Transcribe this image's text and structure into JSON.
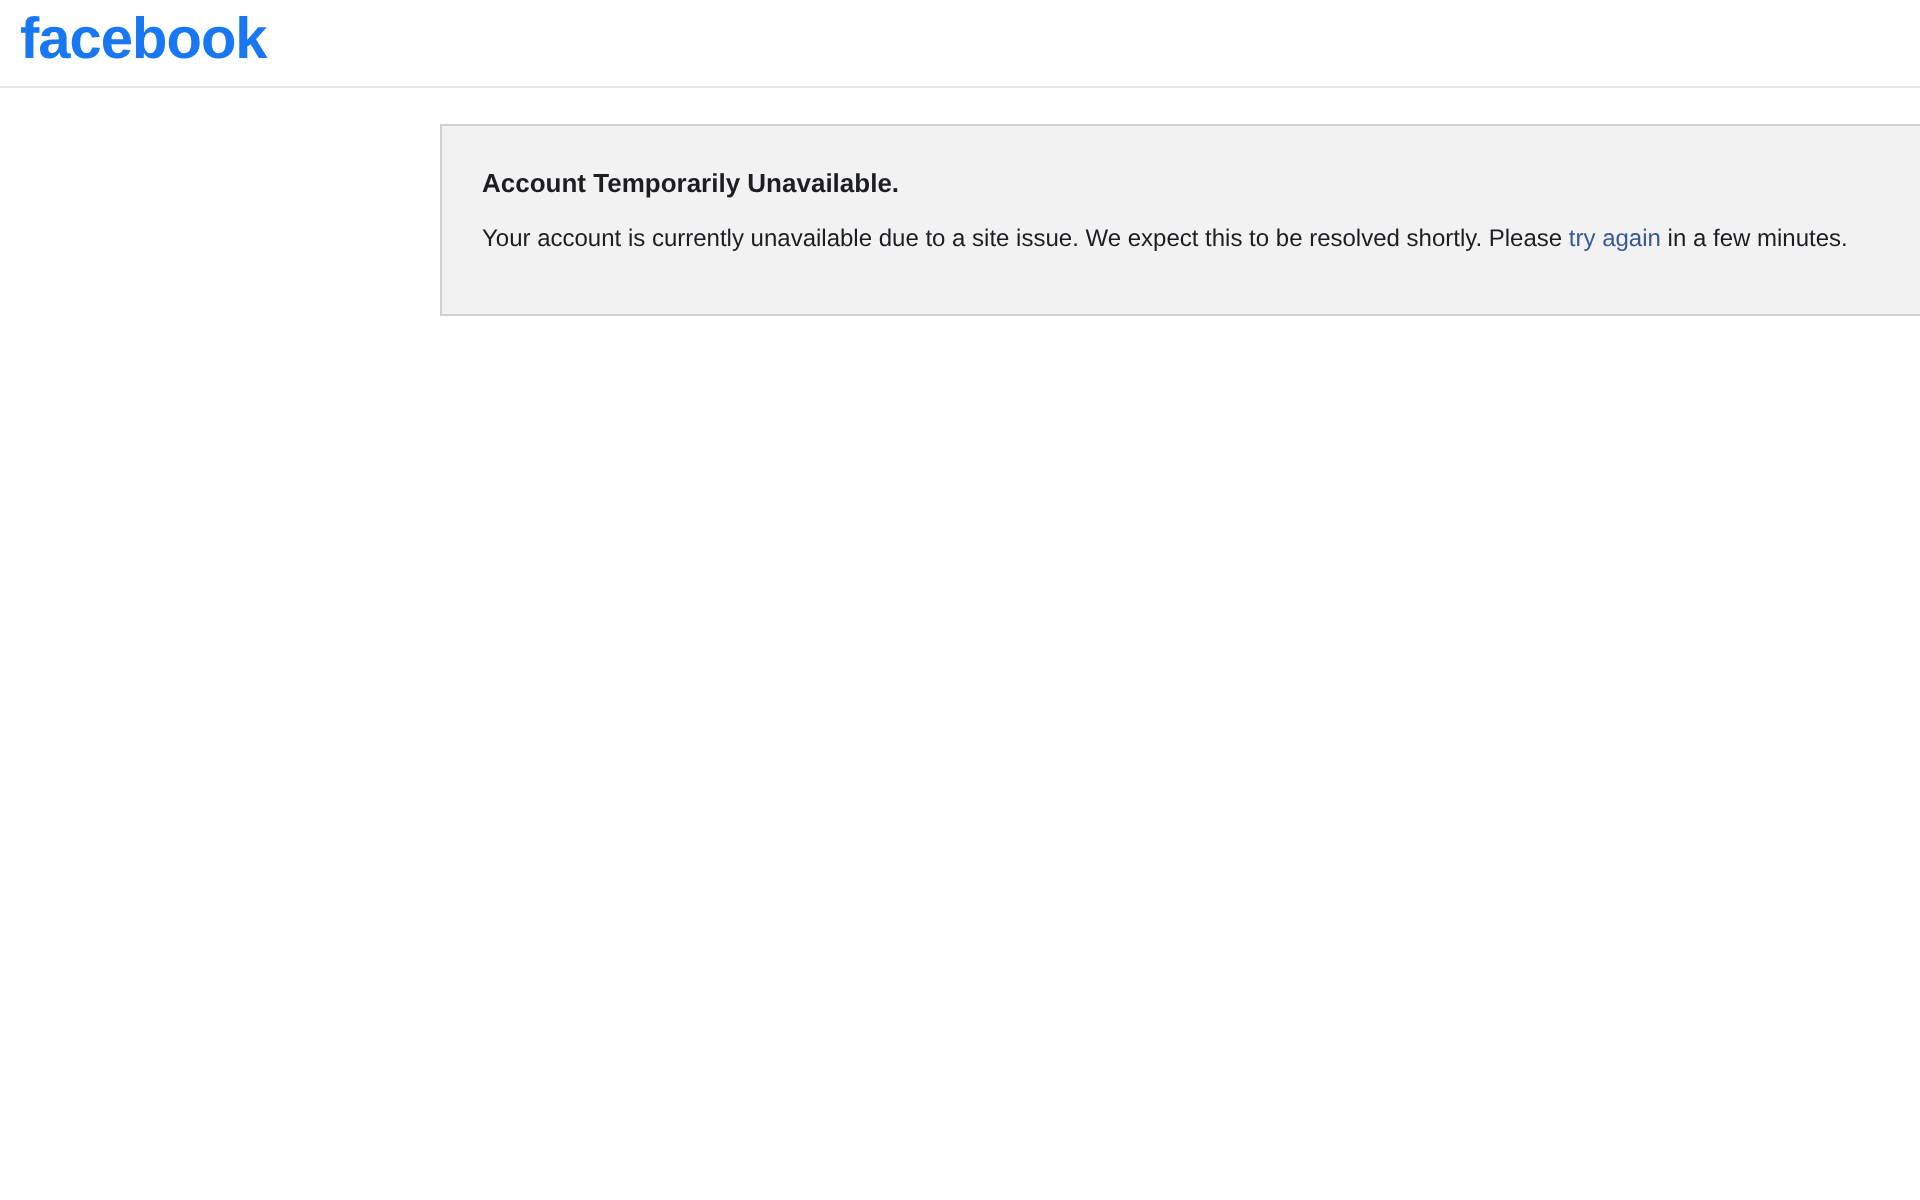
{
  "header": {
    "logo": "facebook"
  },
  "notice": {
    "title": "Account Temporarily Unavailable.",
    "message": {
      "before": "Your account is currently unavailable due to a site issue. We expect this to be resolved shortly. Please",
      "link": "try again",
      "after": "in a few minutes."
    }
  }
}
